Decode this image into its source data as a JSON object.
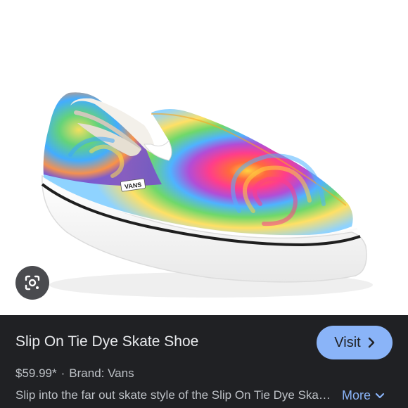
{
  "product": {
    "title": "Slip On Tie Dye Skate Shoe",
    "price": "$59.99*",
    "separator": "·",
    "brand": "Brand: Vans",
    "description": "Slip into the far out skate style of the Slip On Tie Dye Skate Shoe from Vans.",
    "logo_text": "VANS"
  },
  "actions": {
    "visit_label": "Visit",
    "more_label": "More"
  },
  "icons": {
    "lens": "google-lens-icon",
    "visit_arrow": "chevron-right-icon",
    "more_arrow": "chevron-down-icon"
  },
  "colors": {
    "panel_bg": "#202124",
    "accent": "#8ab4f8",
    "text_primary": "#e8eaed",
    "text_secondary": "#bdc1c6"
  }
}
